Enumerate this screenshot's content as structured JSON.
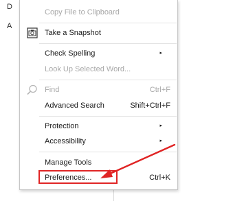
{
  "background": {
    "letters": [
      "D",
      "A"
    ]
  },
  "menu": {
    "items": [
      {
        "label": "Copy File to Clipboard",
        "disabled": true
      },
      {
        "label": "Take a Snapshot",
        "icon": "camera-icon"
      },
      {
        "label": "Check Spelling",
        "submenu": true
      },
      {
        "label": "Look Up Selected Word...",
        "disabled": true
      },
      {
        "label": "Find",
        "shortcut": "Ctrl+F",
        "disabled": true,
        "icon": "search-icon"
      },
      {
        "label": "Advanced Search",
        "shortcut": "Shift+Ctrl+F"
      },
      {
        "label": "Protection",
        "submenu": true
      },
      {
        "label": "Accessibility",
        "submenu": true
      },
      {
        "label": "Manage Tools"
      },
      {
        "label": "Preferences...",
        "shortcut": "Ctrl+K",
        "highlighted": true
      }
    ],
    "submenu_glyph": "▸"
  },
  "annotation": {
    "color": "#e02424"
  }
}
